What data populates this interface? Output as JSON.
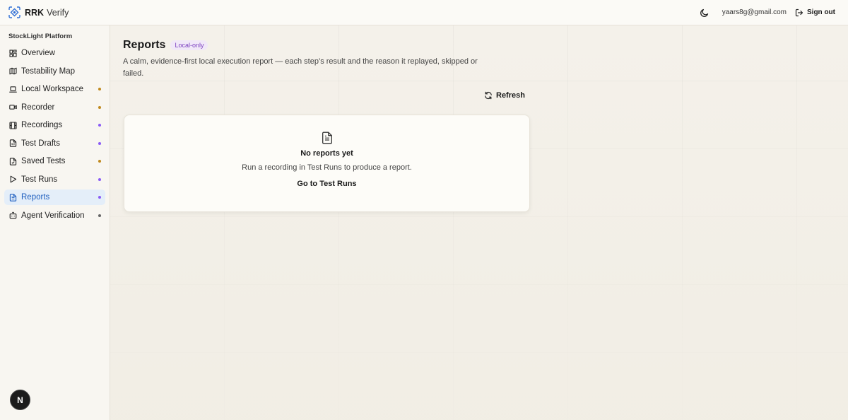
{
  "app": {
    "name": "RRK",
    "name_suffix": "Verify"
  },
  "header": {
    "user_email": "yaars8g@gmail.com",
    "signout_label": "Sign out"
  },
  "sidebar": {
    "section": "StockLight Platform",
    "items": [
      {
        "label": "Overview",
        "icon": "dashboard-icon",
        "dot": null
      },
      {
        "label": "Testability Map",
        "icon": "map-icon",
        "dot": null
      },
      {
        "label": "Local Workspace",
        "icon": "laptop-icon",
        "dot": "#c08a1e"
      },
      {
        "label": "Recorder",
        "icon": "video-icon",
        "dot": "#c08a1e"
      },
      {
        "label": "Recordings",
        "icon": "film-icon",
        "dot": "#8a5cf6"
      },
      {
        "label": "Test Drafts",
        "icon": "file-code-icon",
        "dot": "#8a5cf6"
      },
      {
        "label": "Saved Tests",
        "icon": "file-check-icon",
        "dot": "#c08a1e"
      },
      {
        "label": "Test Runs",
        "icon": "play-icon",
        "dot": "#8a5cf6"
      },
      {
        "label": "Reports",
        "icon": "file-text-icon",
        "dot": "#8a5cf6",
        "active": true
      },
      {
        "label": "Agent Verification",
        "icon": "bot-icon",
        "dot": "#666666"
      }
    ],
    "footer_badge": "N"
  },
  "main": {
    "title": "Reports",
    "badge": "Local-only",
    "description": "A calm, evidence-first local execution report — each step’s result and the reason it replayed, skipped or failed.",
    "refresh_label": "Refresh",
    "empty": {
      "title": "No reports yet",
      "text": "Run a recording in Test Runs to produce a report.",
      "link": "Go to Test Runs"
    }
  },
  "colors": {
    "accent": "#1f5fbf",
    "active_bg": "#e4eef9",
    "badge_text": "#7b3fbf",
    "badge_bg": "#f1e8f8"
  }
}
